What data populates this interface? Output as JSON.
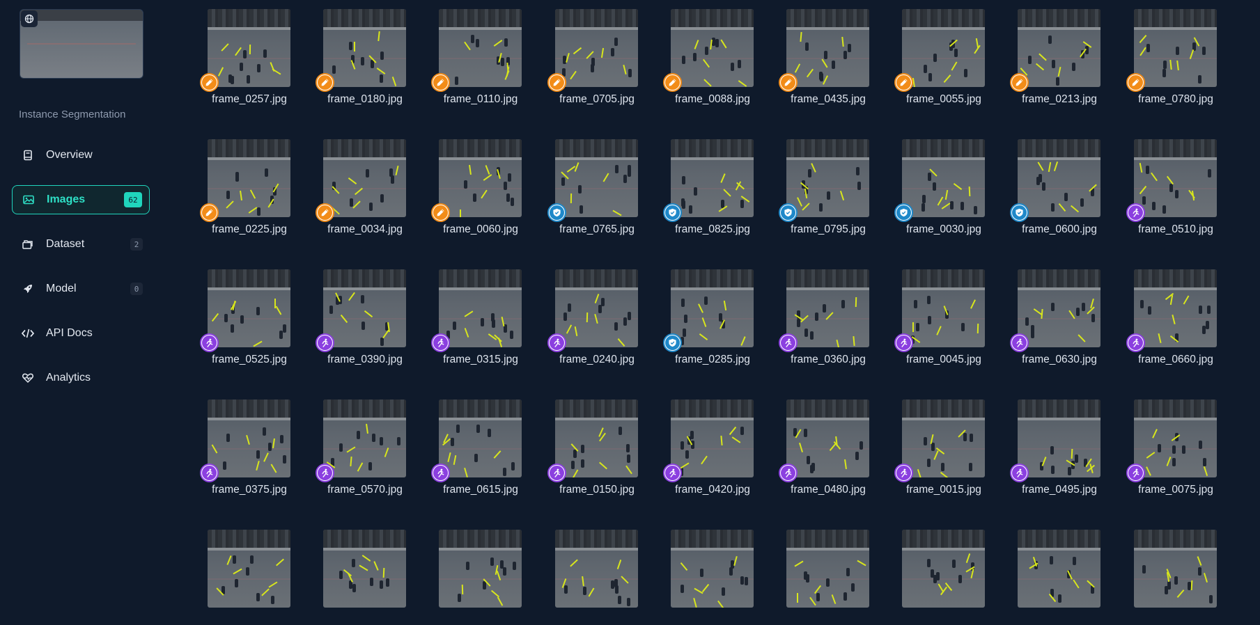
{
  "project": {
    "name": "Instance Segmentation",
    "thumb_icon": "globe-icon"
  },
  "nav": [
    {
      "id": "overview",
      "label": "Overview",
      "icon": "book-icon",
      "count": null,
      "active": false
    },
    {
      "id": "images",
      "label": "Images",
      "icon": "image-icon",
      "count": "62",
      "active": true
    },
    {
      "id": "dataset",
      "label": "Dataset",
      "icon": "folders-icon",
      "count": "2",
      "active": false
    },
    {
      "id": "model",
      "label": "Model",
      "icon": "rocket-icon",
      "count": "0",
      "active": false
    },
    {
      "id": "api-docs",
      "label": "API Docs",
      "icon": "code-icon",
      "count": null,
      "active": false
    },
    {
      "id": "analytics",
      "label": "Analytics",
      "icon": "heart-pulse-icon",
      "count": null,
      "active": false
    }
  ],
  "status_colors": {
    "annotate": "#f28c18",
    "review": "#1e88c9",
    "train": "#8b3fe0",
    "accent": "#20d5bd"
  },
  "images": [
    {
      "name": "frame_0257.jpg",
      "status": "annotate"
    },
    {
      "name": "frame_0180.jpg",
      "status": "annotate"
    },
    {
      "name": "frame_0110.jpg",
      "status": "annotate"
    },
    {
      "name": "frame_0705.jpg",
      "status": "annotate"
    },
    {
      "name": "frame_0088.jpg",
      "status": "annotate"
    },
    {
      "name": "frame_0435.jpg",
      "status": "annotate"
    },
    {
      "name": "frame_0055.jpg",
      "status": "annotate"
    },
    {
      "name": "frame_0213.jpg",
      "status": "annotate"
    },
    {
      "name": "frame_0780.jpg",
      "status": "annotate"
    },
    {
      "name": "frame_0225.jpg",
      "status": "annotate"
    },
    {
      "name": "frame_0034.jpg",
      "status": "annotate"
    },
    {
      "name": "frame_0060.jpg",
      "status": "annotate"
    },
    {
      "name": "frame_0765.jpg",
      "status": "review"
    },
    {
      "name": "frame_0825.jpg",
      "status": "review"
    },
    {
      "name": "frame_0795.jpg",
      "status": "review"
    },
    {
      "name": "frame_0030.jpg",
      "status": "review"
    },
    {
      "name": "frame_0600.jpg",
      "status": "review"
    },
    {
      "name": "frame_0510.jpg",
      "status": "train"
    },
    {
      "name": "frame_0525.jpg",
      "status": "train"
    },
    {
      "name": "frame_0390.jpg",
      "status": "train"
    },
    {
      "name": "frame_0315.jpg",
      "status": "train"
    },
    {
      "name": "frame_0240.jpg",
      "status": "train"
    },
    {
      "name": "frame_0285.jpg",
      "status": "review"
    },
    {
      "name": "frame_0360.jpg",
      "status": "train"
    },
    {
      "name": "frame_0045.jpg",
      "status": "train"
    },
    {
      "name": "frame_0630.jpg",
      "status": "train"
    },
    {
      "name": "frame_0660.jpg",
      "status": "train"
    },
    {
      "name": "frame_0375.jpg",
      "status": "train"
    },
    {
      "name": "frame_0570.jpg",
      "status": "train"
    },
    {
      "name": "frame_0615.jpg",
      "status": "train"
    },
    {
      "name": "frame_0150.jpg",
      "status": "train"
    },
    {
      "name": "frame_0420.jpg",
      "status": "train"
    },
    {
      "name": "frame_0480.jpg",
      "status": "train"
    },
    {
      "name": "frame_0015.jpg",
      "status": "train"
    },
    {
      "name": "frame_0495.jpg",
      "status": "train"
    },
    {
      "name": "frame_0075.jpg",
      "status": "train"
    },
    {
      "name": "",
      "status": ""
    },
    {
      "name": "",
      "status": ""
    },
    {
      "name": "",
      "status": ""
    },
    {
      "name": "",
      "status": ""
    },
    {
      "name": "",
      "status": ""
    },
    {
      "name": "",
      "status": ""
    },
    {
      "name": "",
      "status": ""
    },
    {
      "name": "",
      "status": ""
    },
    {
      "name": "",
      "status": ""
    }
  ]
}
